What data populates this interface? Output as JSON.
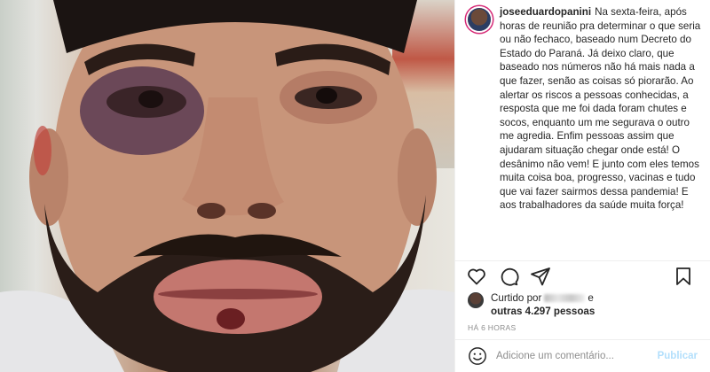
{
  "post": {
    "username": "joseeduardopanini",
    "caption": "Na sexta-feira, após horas de reunião pra determinar o que seria ou não fechaco, baseado num Decreto do Estado do Paraná. Já deixo claro, que baseado nos números não há mais nada a que fazer, senão as coisas só piorarão. Ao alertar os riscos a pessoas conhecidas, a resposta que me foi dada foram chutes e socos, enquanto um me segurava o outro me agredia. Enfim pessoas assim que ajudaram situação chegar onde está! O desânimo não vem! E junto com eles temos muita coisa boa, progresso, vacinas e tudo que vai fazer sairmos dessa pandemia! E aos trabalhadores da saúde muita força!"
  },
  "actions": {
    "like_icon": "heart-icon",
    "comment_icon": "comment-icon",
    "share_icon": "share-icon",
    "save_icon": "bookmark-icon"
  },
  "likes": {
    "prefix": "Curtido por",
    "suffix": "e",
    "others": "outras 4.297 pessoas"
  },
  "timestamp": "HÁ 6 HORAS",
  "comment_box": {
    "placeholder": "Adicione um comentário...",
    "publish_label": "Publicar",
    "emoji_icon": "smiley-icon"
  },
  "colors": {
    "publish": "#b2dffc",
    "text": "#262626",
    "muted": "#8e8e8e",
    "divider": "#efefef"
  }
}
